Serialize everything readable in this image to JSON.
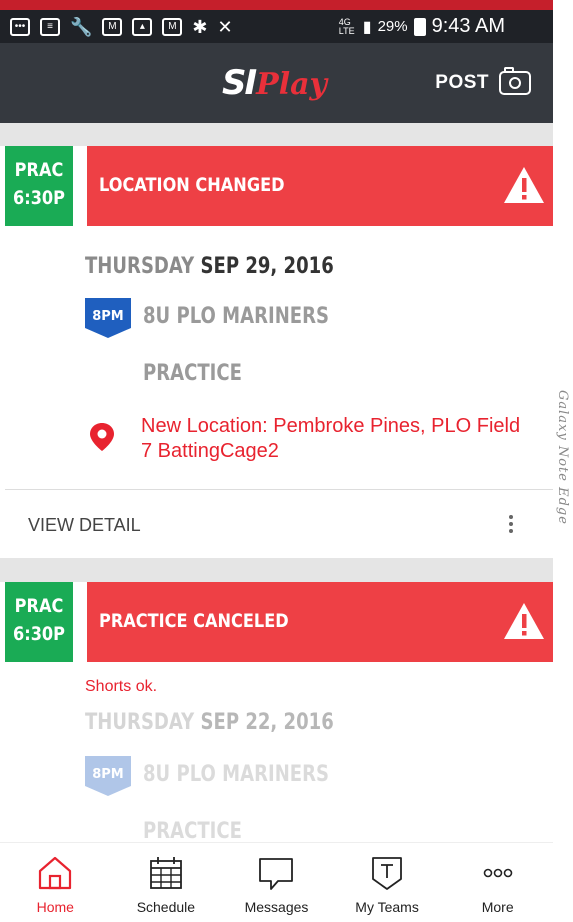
{
  "status_bar": {
    "battery_percent": "29%",
    "time": "9:43 AM",
    "network": "4G LTE"
  },
  "app_bar": {
    "logo_si": "SI",
    "logo_play": "Play",
    "post_label": "POST"
  },
  "device_label": "Galaxy Note Edge",
  "events": [
    {
      "badge_type": "PRAC",
      "badge_time": "6:30P",
      "alert_title": "LOCATION CHANGED",
      "day_of_week": "THURSDAY",
      "date": "SEP 29, 2016",
      "time_flag": "8PM",
      "team": "8U PLO MARINERS",
      "event_type": "PRACTICE",
      "location": "New Location: Pembroke Pines, PLO Field 7 BattingCage2",
      "view_detail": "VIEW DETAIL"
    },
    {
      "badge_type": "PRAC",
      "badge_time": "6:30P",
      "alert_title": "PRACTICE CANCELED",
      "note": "Shorts ok.",
      "day_of_week": "THURSDAY",
      "date": "SEP 22, 2016",
      "time_flag": "8PM",
      "team": "8U PLO MARINERS",
      "event_type": "PRACTICE"
    }
  ],
  "bottom_nav": [
    {
      "label": "Home",
      "icon": "home-icon",
      "active": true
    },
    {
      "label": "Schedule",
      "icon": "calendar-icon",
      "active": false
    },
    {
      "label": "Messages",
      "icon": "message-icon",
      "active": false
    },
    {
      "label": "My Teams",
      "icon": "shield-t-icon",
      "active": false
    },
    {
      "label": "More",
      "icon": "more-dots-icon",
      "active": false
    }
  ],
  "colors": {
    "accent_red": "#ee4045",
    "badge_green": "#1aab55",
    "header_dark": "#35393f",
    "time_flag_blue": "#1f5fbf"
  }
}
